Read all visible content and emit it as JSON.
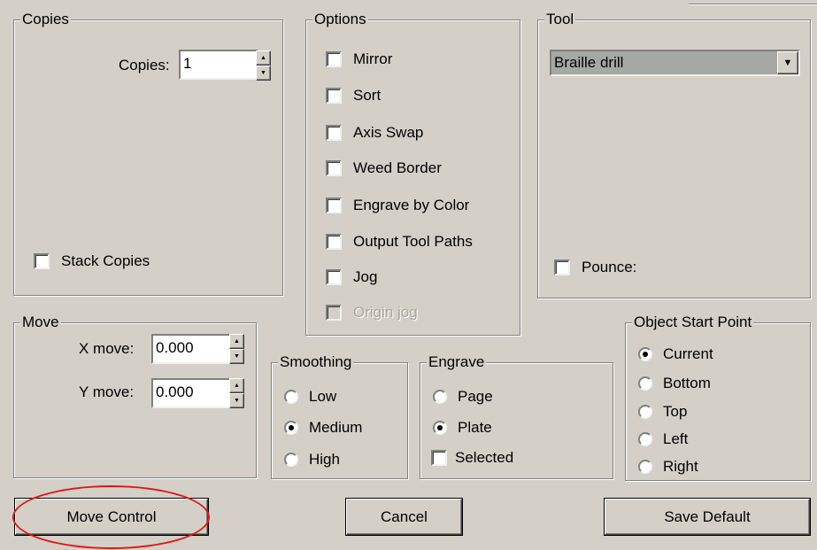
{
  "copies": {
    "legend": "Copies",
    "copies_label": "Copies:",
    "copies_value": "1",
    "stack_label": "Stack Copies"
  },
  "options": {
    "legend": "Options",
    "items": [
      {
        "label": "Mirror",
        "checked": false,
        "disabled": false
      },
      {
        "label": "Sort",
        "checked": false,
        "disabled": false
      },
      {
        "label": "Axis Swap",
        "checked": false,
        "disabled": false
      },
      {
        "label": "Weed Border",
        "checked": false,
        "disabled": false
      },
      {
        "label": "Engrave by Color",
        "checked": false,
        "disabled": false
      },
      {
        "label": "Output Tool Paths",
        "checked": false,
        "disabled": false
      },
      {
        "label": "Jog",
        "checked": false,
        "disabled": false
      },
      {
        "label": "Origin jog",
        "checked": false,
        "disabled": true
      }
    ]
  },
  "tool": {
    "legend": "Tool",
    "selected": "Braille drill",
    "pounce_label": "Pounce:"
  },
  "move": {
    "legend": "Move",
    "x_label": "X move:",
    "x_value": "0.000",
    "y_label": "Y move:",
    "y_value": "0.000"
  },
  "smoothing": {
    "legend": "Smoothing",
    "options": [
      "Low",
      "Medium",
      "High"
    ],
    "selected": "Medium"
  },
  "engrave": {
    "legend": "Engrave",
    "options": [
      "Page",
      "Plate"
    ],
    "selected": "Plate",
    "selected_label": "Selected"
  },
  "start_point": {
    "legend": "Object Start Point",
    "options": [
      "Current",
      "Bottom",
      "Top",
      "Left",
      "Right"
    ],
    "selected": "Current"
  },
  "buttons": {
    "move_control": "Move Control",
    "cancel": "Cancel",
    "save_default": "Save Default"
  },
  "colors": {
    "dialog_bg": "#d4d0c8",
    "combo_bg": "#a6a8a3",
    "highlight_ellipse": "#e01818"
  }
}
